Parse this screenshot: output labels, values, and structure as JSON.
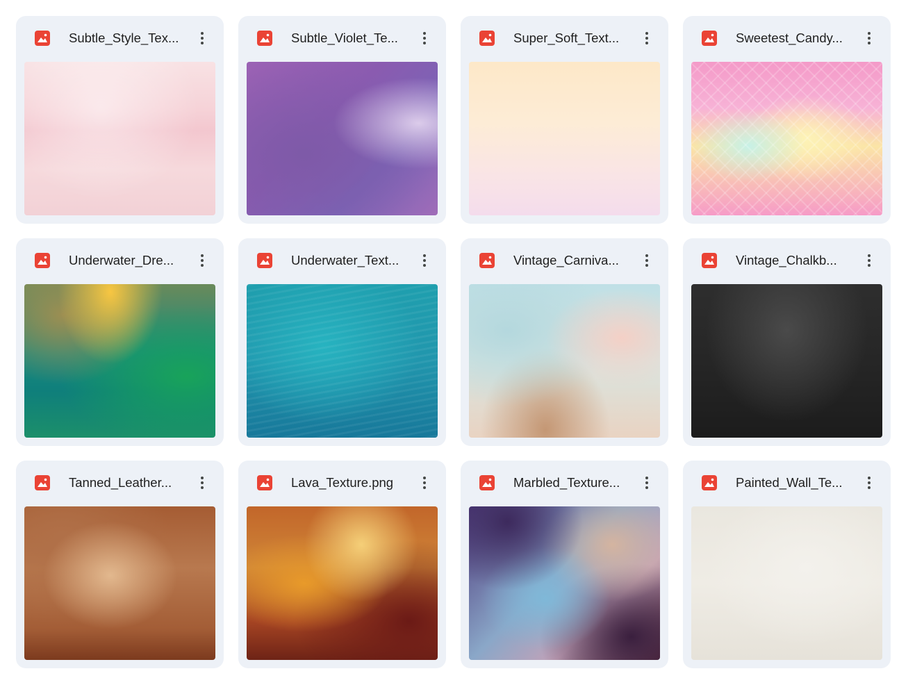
{
  "files": [
    {
      "name": "Subtle_Style_Tex...",
      "icon": "image-icon",
      "thumb": "t-subtle-style"
    },
    {
      "name": "Subtle_Violet_Te...",
      "icon": "image-icon",
      "thumb": "t-subtle-violet"
    },
    {
      "name": "Super_Soft_Text...",
      "icon": "image-icon",
      "thumb": "t-super-soft"
    },
    {
      "name": "Sweetest_Candy...",
      "icon": "image-icon",
      "thumb": "t-sweetest"
    },
    {
      "name": "Underwater_Dre...",
      "icon": "image-icon",
      "thumb": "t-underwater-dre"
    },
    {
      "name": "Underwater_Text...",
      "icon": "image-icon",
      "thumb": "t-underwater-text"
    },
    {
      "name": "Vintage_Carniva...",
      "icon": "image-icon",
      "thumb": "t-vintage-carniva"
    },
    {
      "name": "Vintage_Chalkb...",
      "icon": "image-icon",
      "thumb": "t-vintage-chalk"
    },
    {
      "name": "Tanned_Leather...",
      "icon": "image-icon",
      "thumb": "t-tanned"
    },
    {
      "name": "Lava_Texture.png",
      "icon": "image-icon",
      "thumb": "t-lava"
    },
    {
      "name": "Marbled_Texture...",
      "icon": "image-icon",
      "thumb": "t-marbled"
    },
    {
      "name": "Painted_Wall_Te...",
      "icon": "image-icon",
      "thumb": "t-painted"
    }
  ],
  "colors": {
    "icon_red": "#ea4335",
    "card_bg": "#edf1f7",
    "text": "#1f1f1f"
  }
}
